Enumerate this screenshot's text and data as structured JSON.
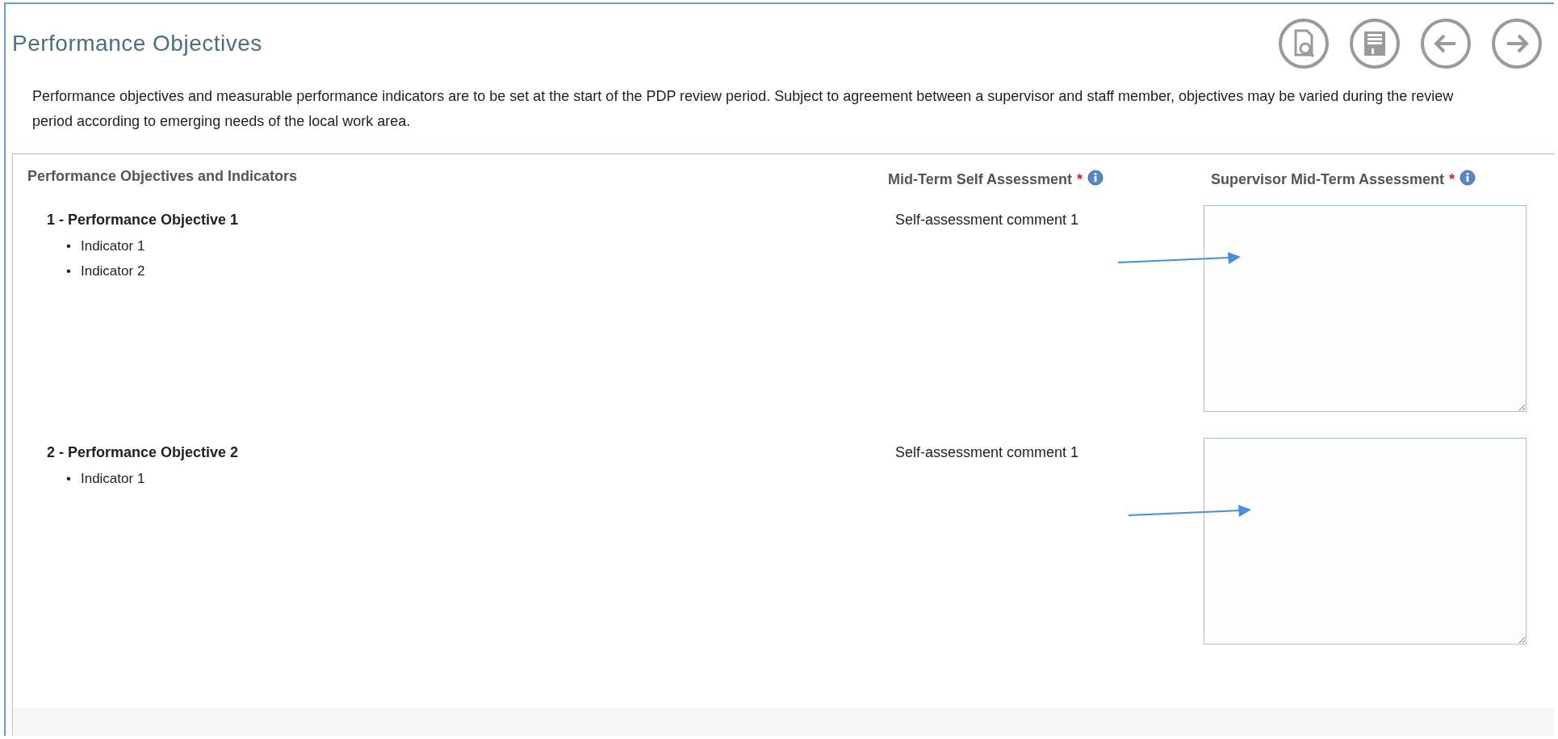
{
  "title": "Performance Objectives",
  "toolbar": [
    {
      "kind": "preview"
    },
    {
      "kind": "save"
    },
    {
      "kind": "back"
    },
    {
      "kind": "forward"
    }
  ],
  "intro": "Performance objectives and measurable performance indicators are to be set at the start of the PDP review period. Subject to agreement between a supervisor and staff member, objectives may be varied during the review period according to emerging needs of the local work area.",
  "columns": [
    {
      "label": "Performance Objectives and Indicators"
    },
    {
      "label": "Mid-Term Self Assessment",
      "required_marker": "*",
      "info_icon": true
    },
    {
      "label": "Supervisor Mid-Term Assessment",
      "required_marker": "*",
      "info_icon": true
    }
  ],
  "objectives": [
    {
      "title": "1 - Performance Objective 1",
      "indicators": [
        {
          "bullet": "•",
          "text": "Indicator 1"
        },
        {
          "bullet": "•",
          "text": "Indicator 2"
        }
      ],
      "self_assessment": "Self-assessment comment 1"
    },
    {
      "title": "2 - Performance Objective 2",
      "indicators": [
        {
          "bullet": "•",
          "text": "Indicator 1"
        }
      ],
      "self_assessment": "Self-assessment comment 1"
    }
  ]
}
